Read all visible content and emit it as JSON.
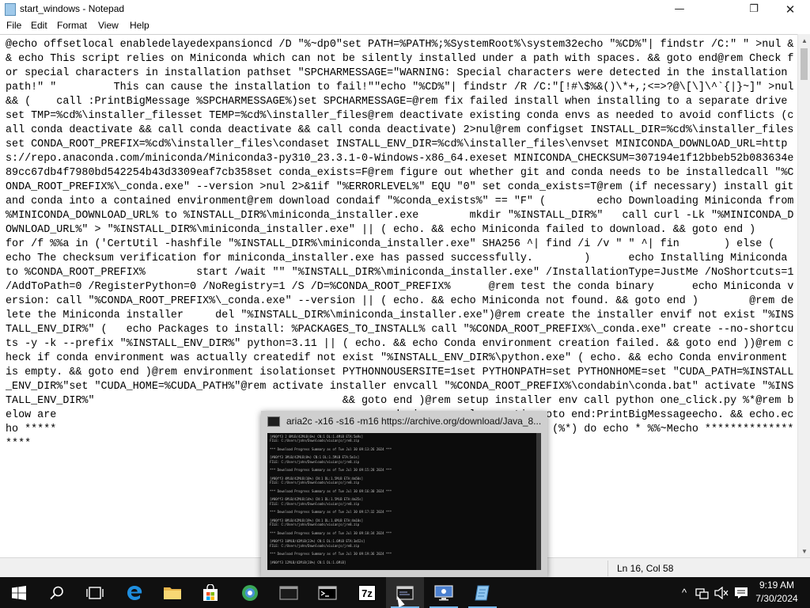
{
  "window": {
    "title": "start_windows - Notepad",
    "minimize_glyph": "—",
    "maximize_glyph": "❐",
    "close_glyph": "✕"
  },
  "menu": {
    "file": "File",
    "edit": "Edit",
    "format": "Format",
    "view": "View",
    "help": "Help"
  },
  "editor": {
    "content": "@echo offsetlocal enabledelayedexpansioncd /D \"%~dp0\"set PATH=%PATH%;%SystemRoot%\\system32echo \"%CD%\"| findstr /C:\" \" >nul && echo This script relies on Miniconda which can not be silently installed under a path with spaces. && goto end@rem Check for special characters in installation pathset \"SPCHARMESSAGE=\"WARNING: Special characters were detected in the installation path!\" \"         This can cause the installation to fail!\"\"echo \"%CD%\"| findstr /R /C:\"[!#\\$%&()\\*+,;<=>?@\\[\\]\\^`{|}~]\" >nul && (    call :PrintBigMessage %SPCHARMESSAGE%)set SPCHARMESSAGE=@rem fix failed install when installing to a separate drive set TMP=%cd%\\installer_filesset TEMP=%cd%\\installer_files@rem deactivate existing conda envs as needed to avoid conflicts (call conda deactivate && call conda deactivate && call conda deactivate) 2>nul@rem configset INSTALL_DIR=%cd%\\installer_filesset CONDA_ROOT_PREFIX=%cd%\\installer_files\\condaset INSTALL_ENV_DIR=%cd%\\installer_files\\envset MINICONDA_DOWNLOAD_URL=https://repo.anaconda.com/miniconda/Miniconda3-py310_23.3.1-0-Windows-x86_64.exeset MINICONDA_CHECKSUM=307194e1f12bbeb52b083634e89cc67db4f7980bd542254b43d3309eaf7cb358set conda_exists=F@rem figure out whether git and conda needs to be installedcall \"%CONDA_ROOT_PREFIX%\\_conda.exe\" --version >nul 2>&1if \"%ERRORLEVEL%\" EQU \"0\" set conda_exists=T@rem (if necessary) install git and conda into a contained environment@rem download condaif \"%conda_exists%\" == \"F\" (        echo Downloading Miniconda from %MINICONDA_DOWNLOAD_URL% to %INSTALL_DIR%\\miniconda_installer.exe        mkdir \"%INSTALL_DIR%\"   call curl -Lk \"%MINICONDA_DOWNLOAD_URL%\" > \"%INSTALL_DIR%\\miniconda_installer.exe\" || ( echo. && echo Miniconda failed to download. && goto end )        for /f %%a in ('CertUtil -hashfile \"%INSTALL_DIR%\\miniconda_installer.exe\" SHA256 ^| find /i /v \" \" ^| fin       ) else (                echo The checksum verification for miniconda_installer.exe has passed successfully.        )      echo Installing Miniconda to %CONDA_ROOT_PREFIX%        start /wait \"\" \"%INSTALL_DIR%\\miniconda_installer.exe\" /InstallationType=JustMe /NoShortcuts=1 /AddToPath=0 /RegisterPython=0 /NoRegistry=1 /S /D=%CONDA_ROOT_PREFIX%      @rem test the conda binary      echo Miniconda version: call \"%CONDA_ROOT_PREFIX%\\_conda.exe\" --version || ( echo. && echo Miniconda not found. && goto end )        @rem delete the Miniconda installer     del \"%INSTALL_DIR%\\miniconda_installer.exe\")@rem create the installer envif not exist \"%INSTALL_ENV_DIR%\" (   echo Packages to install: %PACKAGES_TO_INSTALL% call \"%CONDA_ROOT_PREFIX%\\_conda.exe\" create --no-shortcuts -y -k --prefix \"%INSTALL_ENV_DIR%\" python=3.11 || ( echo. && echo Conda environment creation failed. && goto end ))@rem check if conda environment was actually createdif not exist \"%INSTALL_ENV_DIR%\\python.exe\" ( echo. && echo Conda environment is empty. && goto end )@rem environment isolationset PYTHONNOUSERSITE=1set PYTHONPATH=set PYTHONHOME=set \"CUDA_PATH=%INSTALL_ENV_DIR%\"set \"CUDA_HOME=%CUDA_PATH%\"@rem activate installer envcall \"%CONDA_ROOT_PREFIX%\\condabin\\conda.bat\" activate \"%INSTALL_ENV_DIR%\"                                       && goto end )@rem setup installer env call python one_click.py %*@rem below are                                                nese during normal executiongoto end:PrintBigMessageecho. && echo.echo *****                                                 ******************for %%M in (%*) do echo * %%~Mecho ******************                                     o. && echo.exit /b:endpause"
  },
  "status": {
    "position": "Ln 16, Col 58"
  },
  "preview": {
    "title": "aria2c  -x16 -s16 -m16 https://archive.org/download/Java_8...",
    "console": "[#00ff3 2 8MiB/42MiB(6%) CN:1 DL:1.4MiB ETA:5m9s]\nFILE: C:/Users/john/Downloads/xiuianjs/jre8.zip\n\n*** Download Progress Summary as of Tue Jul 30 09:13:26 2024 ***\n\n[#00ff3 3MiB/42MiB(8%) CN:1 DL:1.5MiB ETA:5m1s]\nFILE: C:/Users/john/Downloads/xiuianjs/jre8.zip\n\n*** Download Progress Summary as of Tue Jul 30 09:15:28 2024 ***\n\n[#00ff3 4MiB/42MiB(10%) CN:1 DL:1.5MiB ETA:4m50s]\nFILE: C:/Users/john/Downloads/xiuianjs/jre8.zip\n\n*** Download Progress Summary as of Tue Jul 30 09:16:30 2024 ***\n\n[#00ff3 6MiB/42MiB(14%) CN:1 DL:1.5MiB ETA:4m35s]\nFILE: C:/Users/john/Downloads/xiuianjs/jre8.zip\n\n*** Download Progress Summary as of Tue Jul 30 09:17:32 2024 ***\n\n[#00ff3 8MiB/42MiB(19%) CN:1 DL:1.6MiB ETA:4m10s]\nFILE: C:/Users/john/Downloads/xiuianjs/jre8.zip\n\n*** Download Progress Summary as of Tue Jul 30 09:18:34 2024 ***\n\n[#00ff3 10MiB/42MiB(23%) CN:1 DL:1.6MiB ETA:3m52s]\nFILE: C:/Users/john/Downloads/xiuianjs/jre8.zip\n\n*** Download Progress Summary as of Tue Jul 30 09:19:36 2024 ***\n\n[#00ff3 12MiB/42MiB(28%) CN:1 DL:1.6MiB]"
  },
  "taskbar": {
    "items": [
      {
        "name": "start-button",
        "icon": "windows-logo-icon"
      },
      {
        "name": "search-button",
        "icon": "search-icon"
      },
      {
        "name": "task-view-button",
        "icon": "task-view-icon"
      },
      {
        "name": "edge-taskbar-button",
        "icon": "edge-icon"
      },
      {
        "name": "file-explorer-taskbar-button",
        "icon": "folder-icon"
      },
      {
        "name": "store-taskbar-button",
        "icon": "store-icon"
      },
      {
        "name": "browser-taskbar-button",
        "icon": "globe-icon"
      },
      {
        "name": "app-window-taskbar-button",
        "icon": "window-icon"
      },
      {
        "name": "command-prompt-taskbar-button",
        "icon": "terminal-icon"
      },
      {
        "name": "7zip-taskbar-button",
        "icon": "7zip-icon",
        "label": "7z"
      },
      {
        "name": "aria2c-console-taskbar-button",
        "icon": "console-window-icon"
      },
      {
        "name": "remote-desktop-taskbar-button",
        "icon": "monitor-icon"
      },
      {
        "name": "notepad-taskbar-button",
        "icon": "notepad-icon"
      }
    ],
    "tray": {
      "chevron": "^",
      "network_icon": "network-icon",
      "volume_icon": "volume-muted-icon",
      "notifications_icon": "action-center-icon"
    },
    "clock": {
      "time": "9:19 AM",
      "date": "7/30/2024"
    }
  },
  "colors": {
    "taskbar_bg": "#101010",
    "accent": "#76b9ed",
    "console_bg": "#0c0c0c"
  }
}
